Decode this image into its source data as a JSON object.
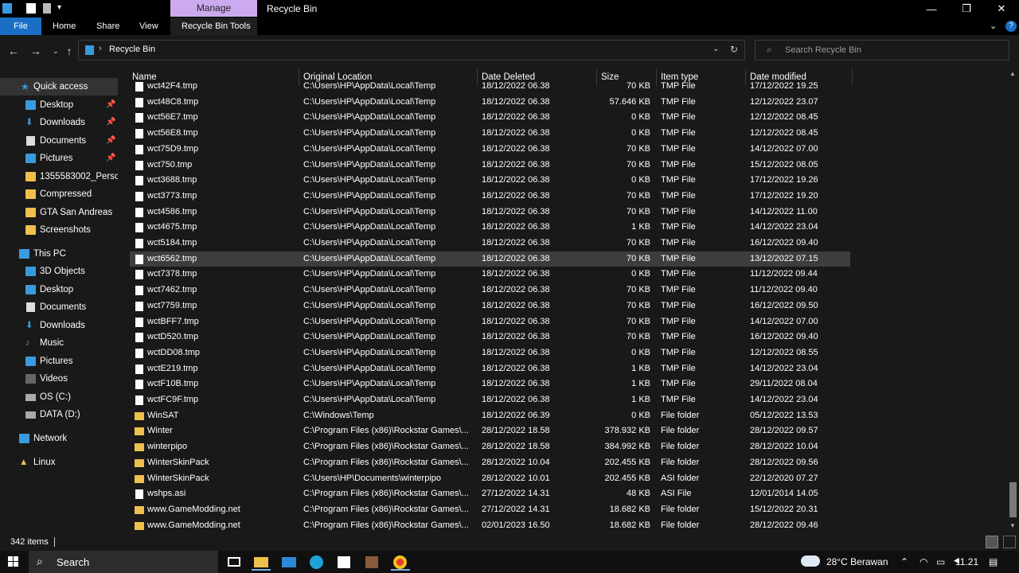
{
  "titlebar": {
    "manage_tab": "Manage",
    "title": "Recycle Bin",
    "minimize_glyph": "—",
    "maximize_glyph": "❐",
    "close_glyph": "✕"
  },
  "ribbon": {
    "tabs": [
      "File",
      "Home",
      "Share",
      "View",
      "Recycle Bin Tools"
    ]
  },
  "address": {
    "path": "Recycle Bin",
    "separator": "›",
    "search_placeholder": "Search Recycle Bin"
  },
  "sidebar": {
    "quick_access": "Quick access",
    "pinned": [
      {
        "label": "Desktop",
        "icon": "desktop-icon"
      },
      {
        "label": "Downloads",
        "icon": "downloads-icon"
      },
      {
        "label": "Documents",
        "icon": "documents-icon"
      },
      {
        "label": "Pictures",
        "icon": "pictures-icon"
      }
    ],
    "folders": [
      "1355583002_Persona",
      "Compressed",
      "GTA San Andreas",
      "Screenshots"
    ],
    "this_pc": "This PC",
    "pc_items": [
      "3D Objects",
      "Desktop",
      "Documents",
      "Downloads",
      "Music",
      "Pictures",
      "Videos",
      "OS (C:)",
      "DATA (D:)"
    ],
    "network": "Network",
    "linux": "Linux"
  },
  "columns": {
    "name": "Name",
    "original_location": "Original Location",
    "date_deleted": "Date Deleted",
    "size": "Size",
    "item_type": "Item type",
    "date_modified": "Date modified"
  },
  "files": [
    {
      "name": "wct42F4.tmp",
      "loc": "C:\\Users\\HP\\AppData\\Local\\Temp",
      "deleted": "18/12/2022 06.38",
      "size": "70 KB",
      "type": "TMP File",
      "modified": "17/12/2022 19.25",
      "kind": "file"
    },
    {
      "name": "wct48C8.tmp",
      "loc": "C:\\Users\\HP\\AppData\\Local\\Temp",
      "deleted": "18/12/2022 06.38",
      "size": "57.646 KB",
      "type": "TMP File",
      "modified": "12/12/2022 23.07",
      "kind": "file"
    },
    {
      "name": "wct56E7.tmp",
      "loc": "C:\\Users\\HP\\AppData\\Local\\Temp",
      "deleted": "18/12/2022 06.38",
      "size": "0 KB",
      "type": "TMP File",
      "modified": "12/12/2022 08.45",
      "kind": "file"
    },
    {
      "name": "wct56E8.tmp",
      "loc": "C:\\Users\\HP\\AppData\\Local\\Temp",
      "deleted": "18/12/2022 06.38",
      "size": "0 KB",
      "type": "TMP File",
      "modified": "12/12/2022 08.45",
      "kind": "file"
    },
    {
      "name": "wct75D9.tmp",
      "loc": "C:\\Users\\HP\\AppData\\Local\\Temp",
      "deleted": "18/12/2022 06.38",
      "size": "70 KB",
      "type": "TMP File",
      "modified": "14/12/2022 07.00",
      "kind": "file"
    },
    {
      "name": "wct750.tmp",
      "loc": "C:\\Users\\HP\\AppData\\Local\\Temp",
      "deleted": "18/12/2022 06.38",
      "size": "70 KB",
      "type": "TMP File",
      "modified": "15/12/2022 08.05",
      "kind": "file"
    },
    {
      "name": "wct3688.tmp",
      "loc": "C:\\Users\\HP\\AppData\\Local\\Temp",
      "deleted": "18/12/2022 06.38",
      "size": "0 KB",
      "type": "TMP File",
      "modified": "17/12/2022 19.26",
      "kind": "file"
    },
    {
      "name": "wct3773.tmp",
      "loc": "C:\\Users\\HP\\AppData\\Local\\Temp",
      "deleted": "18/12/2022 06.38",
      "size": "70 KB",
      "type": "TMP File",
      "modified": "17/12/2022 19.20",
      "kind": "file"
    },
    {
      "name": "wct4586.tmp",
      "loc": "C:\\Users\\HP\\AppData\\Local\\Temp",
      "deleted": "18/12/2022 06.38",
      "size": "70 KB",
      "type": "TMP File",
      "modified": "14/12/2022 11.00",
      "kind": "file"
    },
    {
      "name": "wct4675.tmp",
      "loc": "C:\\Users\\HP\\AppData\\Local\\Temp",
      "deleted": "18/12/2022 06.38",
      "size": "1 KB",
      "type": "TMP File",
      "modified": "14/12/2022 23.04",
      "kind": "file"
    },
    {
      "name": "wct5184.tmp",
      "loc": "C:\\Users\\HP\\AppData\\Local\\Temp",
      "deleted": "18/12/2022 06.38",
      "size": "70 KB",
      "type": "TMP File",
      "modified": "16/12/2022 09.40",
      "kind": "file"
    },
    {
      "name": "wct6562.tmp",
      "loc": "C:\\Users\\HP\\AppData\\Local\\Temp",
      "deleted": "18/12/2022 06.38",
      "size": "70 KB",
      "type": "TMP File",
      "modified": "13/12/2022 07.15",
      "kind": "file",
      "selected": true
    },
    {
      "name": "wct7378.tmp",
      "loc": "C:\\Users\\HP\\AppData\\Local\\Temp",
      "deleted": "18/12/2022 06.38",
      "size": "0 KB",
      "type": "TMP File",
      "modified": "11/12/2022 09.44",
      "kind": "file"
    },
    {
      "name": "wct7462.tmp",
      "loc": "C:\\Users\\HP\\AppData\\Local\\Temp",
      "deleted": "18/12/2022 06.38",
      "size": "70 KB",
      "type": "TMP File",
      "modified": "11/12/2022 09.40",
      "kind": "file"
    },
    {
      "name": "wct7759.tmp",
      "loc": "C:\\Users\\HP\\AppData\\Local\\Temp",
      "deleted": "18/12/2022 06.38",
      "size": "70 KB",
      "type": "TMP File",
      "modified": "16/12/2022 09.50",
      "kind": "file"
    },
    {
      "name": "wctBFF7.tmp",
      "loc": "C:\\Users\\HP\\AppData\\Local\\Temp",
      "deleted": "18/12/2022 06.38",
      "size": "70 KB",
      "type": "TMP File",
      "modified": "14/12/2022 07.00",
      "kind": "file"
    },
    {
      "name": "wctD520.tmp",
      "loc": "C:\\Users\\HP\\AppData\\Local\\Temp",
      "deleted": "18/12/2022 06.38",
      "size": "70 KB",
      "type": "TMP File",
      "modified": "16/12/2022 09.40",
      "kind": "file"
    },
    {
      "name": "wctDD08.tmp",
      "loc": "C:\\Users\\HP\\AppData\\Local\\Temp",
      "deleted": "18/12/2022 06.38",
      "size": "0 KB",
      "type": "TMP File",
      "modified": "12/12/2022 08.55",
      "kind": "file"
    },
    {
      "name": "wctE219.tmp",
      "loc": "C:\\Users\\HP\\AppData\\Local\\Temp",
      "deleted": "18/12/2022 06.38",
      "size": "1 KB",
      "type": "TMP File",
      "modified": "14/12/2022 23.04",
      "kind": "file"
    },
    {
      "name": "wctF10B.tmp",
      "loc": "C:\\Users\\HP\\AppData\\Local\\Temp",
      "deleted": "18/12/2022 06.38",
      "size": "1 KB",
      "type": "TMP File",
      "modified": "29/11/2022 08.04",
      "kind": "file"
    },
    {
      "name": "wctFC9F.tmp",
      "loc": "C:\\Users\\HP\\AppData\\Local\\Temp",
      "deleted": "18/12/2022 06.38",
      "size": "1 KB",
      "type": "TMP File",
      "modified": "14/12/2022 23.04",
      "kind": "file"
    },
    {
      "name": "WinSAT",
      "loc": "C:\\Windows\\Temp",
      "deleted": "18/12/2022 06.39",
      "size": "0 KB",
      "type": "File folder",
      "modified": "05/12/2022 13.53",
      "kind": "folder"
    },
    {
      "name": "Winter",
      "loc": "C:\\Program Files (x86)\\Rockstar Games\\...",
      "deleted": "28/12/2022 18.58",
      "size": "378.932 KB",
      "type": "File folder",
      "modified": "28/12/2022 09.57",
      "kind": "folder"
    },
    {
      "name": "winterpipo",
      "loc": "C:\\Program Files (x86)\\Rockstar Games\\...",
      "deleted": "28/12/2022 18.58",
      "size": "384.992 KB",
      "type": "File folder",
      "modified": "28/12/2022 10.04",
      "kind": "folder"
    },
    {
      "name": "WinterSkinPack",
      "loc": "C:\\Program Files (x86)\\Rockstar Games\\...",
      "deleted": "28/12/2022 10.04",
      "size": "202.455 KB",
      "type": "File folder",
      "modified": "28/12/2022 09.56",
      "kind": "folder"
    },
    {
      "name": "WinterSkinPack",
      "loc": "C:\\Users\\HP\\Documents\\winterpipo",
      "deleted": "28/12/2022 10.01",
      "size": "202.455 KB",
      "type": "ASI folder",
      "modified": "22/12/2020 07.27",
      "kind": "folder"
    },
    {
      "name": "wshps.asi",
      "loc": "C:\\Program Files (x86)\\Rockstar Games\\...",
      "deleted": "27/12/2022 14.31",
      "size": "48 KB",
      "type": "ASI File",
      "modified": "12/01/2014 14.05",
      "kind": "file"
    },
    {
      "name": "www.GameModding.net",
      "loc": "C:\\Program Files (x86)\\Rockstar Games\\...",
      "deleted": "27/12/2022 14.31",
      "size": "18.682 KB",
      "type": "File folder",
      "modified": "15/12/2022 20.31",
      "kind": "folder"
    },
    {
      "name": "www.GameModding.net",
      "loc": "C:\\Program Files (x86)\\Rockstar Games\\...",
      "deleted": "02/01/2023 16.50",
      "size": "18.682 KB",
      "type": "File folder",
      "modified": "28/12/2022 09.46",
      "kind": "folder"
    }
  ],
  "status": {
    "count": "342 items"
  },
  "taskbar": {
    "search_label": "Search",
    "weather": "28°C  Berawan",
    "time": "11.21",
    "apps": [
      "task-view-icon",
      "file-explorer-icon",
      "mail-icon",
      "edge-icon",
      "store-icon",
      "game-icon",
      "chrome-icon"
    ]
  },
  "colors": {
    "accent": "#1a6fc4",
    "manage_tab": "#ccaaf0",
    "folder": "#f0c04c",
    "selected_row": "#3d3d3d",
    "background": "#191919"
  }
}
